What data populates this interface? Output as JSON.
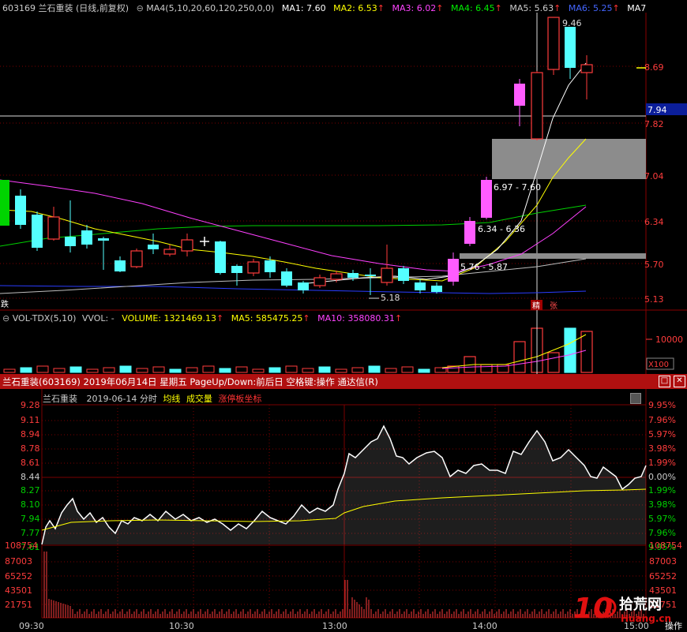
{
  "kline_header": {
    "stock": "603169 兰石重装 (日线,前复权)",
    "ma_indicator": "MA4(5,10,20,60,120,250,0,0)",
    "ma1": "MA1: 7.60",
    "ma2": "MA2: 6.53",
    "ma3": "MA3: 6.02",
    "ma4": "MA4: 6.45",
    "ma5": "MA5: 5.63",
    "ma6": "MA6: 5.25",
    "ma7": "MA7"
  },
  "kline_axis": [
    "8.69",
    "7.82",
    "7.04",
    "6.34",
    "5.70",
    "5.13"
  ],
  "kline_current_price": "7.94",
  "kline_annotations": {
    "low_label": "5.18",
    "high_label": "9.46",
    "zone1": "6.97 - 7.60",
    "zone2": "6.34 - 6.36",
    "zone3": "5.76 - 5.87",
    "left_tag": "跌",
    "tag1": "精",
    "tag2": "张"
  },
  "volume_header": {
    "indicator": "VOL-TDX(5,10)",
    "vvol": "VVOL: -",
    "volume": "VOLUME: 1321469.13",
    "ma5": "MA5: 585475.25",
    "ma10": "MA10: 358080.31"
  },
  "volume_axis": {
    "top": "10000",
    "unit": "X100"
  },
  "intraday_title": "兰石重装(603169) 2019年06月14日 星期五 PageUp/Down:前后日 空格键:操作 通达信(R)",
  "intraday_header": {
    "name": "兰石重装",
    "date": "2019-06-14 分时",
    "avg_line": "均线",
    "volume": "成交量",
    "limit": "涨停板坐标"
  },
  "intraday_price_axis": [
    "9.28",
    "9.11",
    "8.94",
    "8.78",
    "8.61",
    "8.44",
    "8.27",
    "8.10",
    "7.94",
    "7.77",
    "7.61"
  ],
  "intraday_pct_axis": [
    "9.95%",
    "7.96%",
    "5.97%",
    "3.98%",
    "1.99%",
    "0.00%",
    "1.99%",
    "3.98%",
    "5.97%",
    "7.96%",
    "9.95%"
  ],
  "intraday_vol_axis": [
    "108754",
    "87003",
    "65252",
    "43501",
    "21751"
  ],
  "time_axis": [
    "09:30",
    "10:30",
    "13:00",
    "14:00",
    "15:00"
  ],
  "watermark": {
    "num": "10",
    "text1": "拾荒网",
    "text2": "Huang.cn"
  },
  "bottom_right": "操作",
  "colors": {
    "up": "#ff3c3c",
    "down": "#54ffff",
    "limit_up": "#ff5cff",
    "ma1": "#ffffff",
    "ma2": "#ffff00",
    "ma3": "#ff40ff",
    "ma4": "#00e000",
    "ma5": "#c0c0c0",
    "ma6": "#3040ff"
  }
}
